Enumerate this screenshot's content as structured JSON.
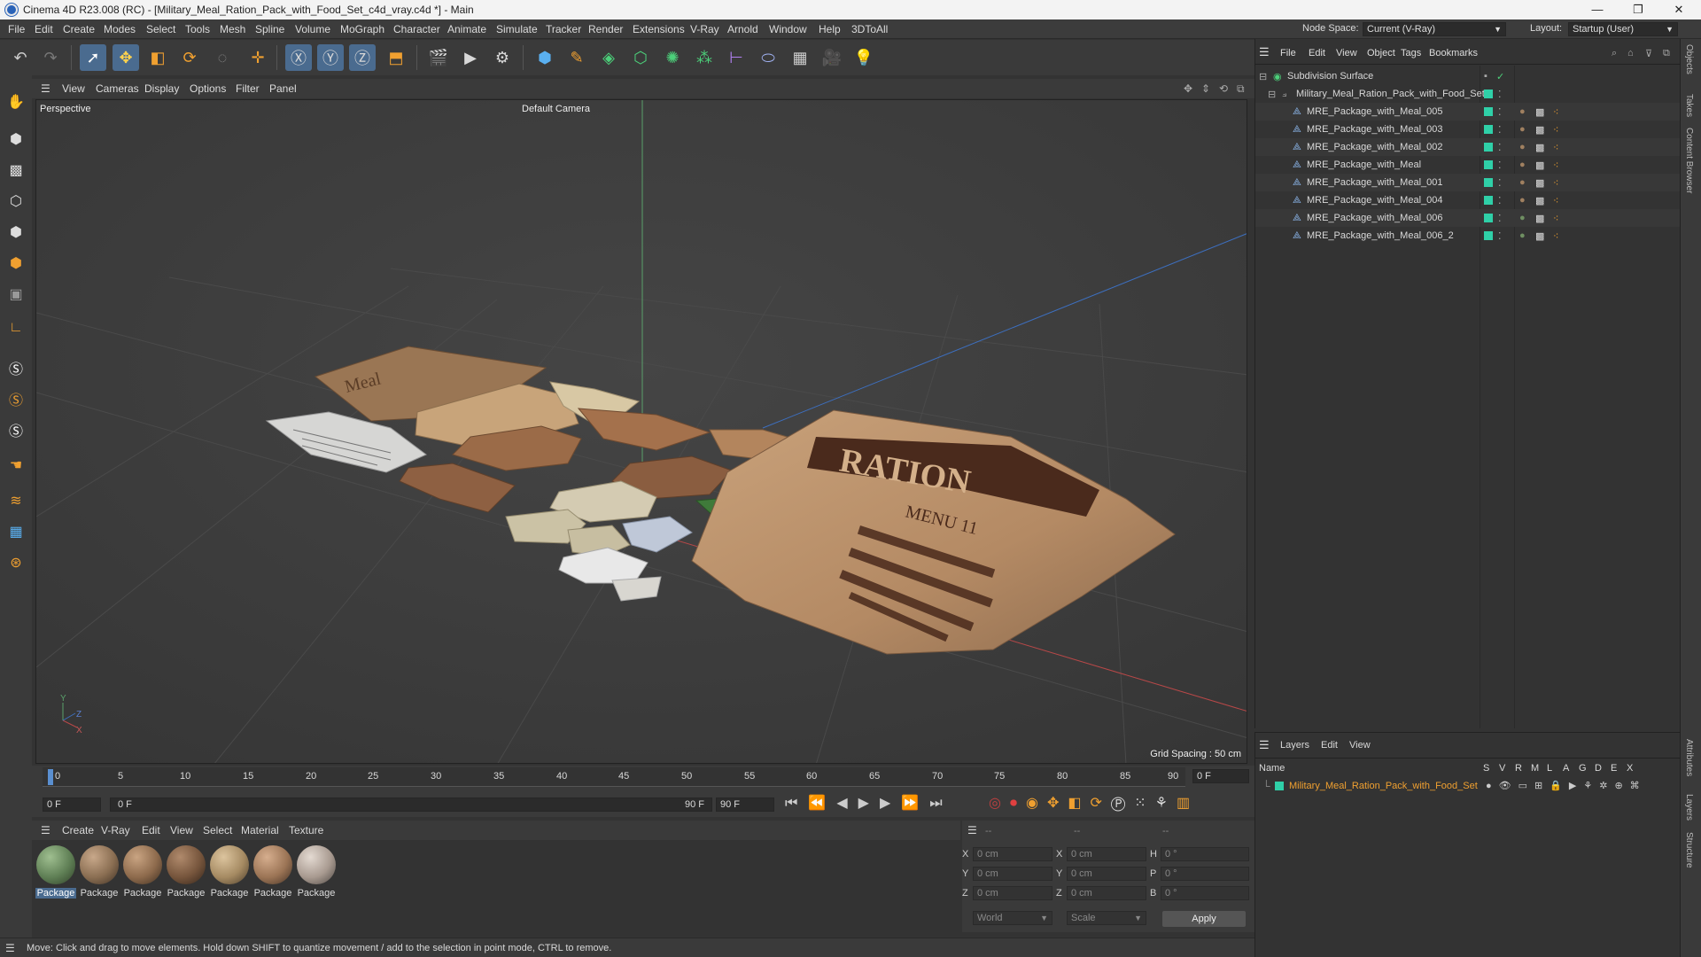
{
  "app": {
    "title": "Cinema 4D R23.008 (RC) - [Military_Meal_Ration_Pack_with_Food_Set_c4d_vray.c4d *] - Main",
    "minimize": "—",
    "maximize": "❐",
    "close": "✕"
  },
  "menubar": {
    "items": [
      "File",
      "Edit",
      "Create",
      "Modes",
      "Select",
      "Tools",
      "Mesh",
      "Spline",
      "Volume",
      "MoGraph",
      "Character",
      "Animate",
      "Simulate",
      "Tracker",
      "Render",
      "Extensions",
      "V-Ray",
      "Arnold",
      "Window",
      "Help",
      "3DToAll"
    ],
    "node_space_label": "Node Space:",
    "node_space_value": "Current (V-Ray)",
    "layout_label": "Layout:",
    "layout_value": "Startup (User)"
  },
  "viewport": {
    "menu": [
      "View",
      "Cameras",
      "Display",
      "Options",
      "Filter",
      "Panel"
    ],
    "name": "Perspective",
    "camera": "Default Camera",
    "grid_spacing": "Grid Spacing : 50 cm",
    "axis_y": "Y",
    "axis_z": "Z",
    "axis_x": "X",
    "ration_text": "RATION",
    "menu_text": "MENU 11",
    "pack_text": "Meal"
  },
  "timeline": {
    "ticks": [
      "0",
      "5",
      "10",
      "15",
      "20",
      "25",
      "30",
      "35",
      "40",
      "45",
      "50",
      "55",
      "60",
      "65",
      "70",
      "75",
      "80",
      "85",
      "90"
    ],
    "current_frame_right": "0 F",
    "start_field": "0 F",
    "range_start": "0 F",
    "range_end": "90 F",
    "end_field": "90 F"
  },
  "materials": {
    "menu": [
      "Create",
      "V-Ray",
      "Edit",
      "View",
      "Select",
      "Material",
      "Texture"
    ],
    "items": [
      {
        "label": "Package",
        "color": "#5f7f55"
      },
      {
        "label": "Package",
        "color": "#8a6e52"
      },
      {
        "label": "Package",
        "color": "#8d6a4c"
      },
      {
        "label": "Package",
        "color": "#76553c"
      },
      {
        "label": "Package",
        "color": "#a58a62"
      },
      {
        "label": "Package",
        "color": "#9b7455"
      },
      {
        "label": "Package",
        "color": "#a89a90"
      }
    ]
  },
  "coords": {
    "headers": [
      "--",
      "--",
      "--"
    ],
    "rows": [
      {
        "a": "X",
        "av": "0 cm",
        "b": "X",
        "bv": "0 cm",
        "c": "H",
        "cv": "0 °"
      },
      {
        "a": "Y",
        "av": "0 cm",
        "b": "Y",
        "bv": "0 cm",
        "c": "P",
        "cv": "0 °"
      },
      {
        "a": "Z",
        "av": "0 cm",
        "b": "Z",
        "bv": "0 cm",
        "c": "B",
        "cv": "0 °"
      }
    ],
    "world": "World",
    "scale": "Scale",
    "apply": "Apply"
  },
  "status": "Move: Click and drag to move elements. Hold down SHIFT to quantize movement / add to the selection in point mode, CTRL to remove.",
  "objects": {
    "menu": [
      "File",
      "Edit",
      "View",
      "Object",
      "Tags",
      "Bookmarks"
    ],
    "root": "Subdivision Surface",
    "group": "Military_Meal_Ration_Pack_with_Food_Set",
    "children": [
      "MRE_Package_with_Meal_005",
      "MRE_Package_with_Meal_003",
      "MRE_Package_with_Meal_002",
      "MRE_Package_with_Meal",
      "MRE_Package_with_Meal_001",
      "MRE_Package_with_Meal_004",
      "MRE_Package_with_Meal_006",
      "MRE_Package_with_Meal_006_2"
    ]
  },
  "layers": {
    "menu": [
      "Layers",
      "Edit",
      "View"
    ],
    "name_header": "Name",
    "col_headers": [
      "S",
      "V",
      "R",
      "M",
      "L",
      "A",
      "G",
      "D",
      "E",
      "X"
    ],
    "layer_name": "Military_Meal_Ration_Pack_with_Food_Set"
  },
  "side_tabs": [
    "Objects",
    "Takes",
    "Content Browser",
    "Attributes",
    "Layers",
    "Structure"
  ]
}
